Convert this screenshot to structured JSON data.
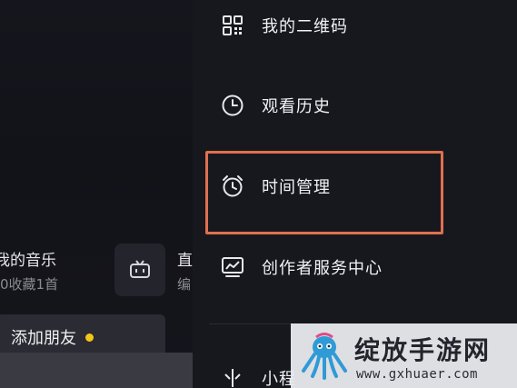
{
  "left": {
    "music_title": "我的音乐",
    "music_sub": "0收藏1首",
    "cut_title": "直",
    "cut_sub": "编",
    "add_friend_label": "添加朋友"
  },
  "menu": {
    "items": [
      {
        "label": "我的二维码",
        "icon": "qr-code-icon"
      },
      {
        "label": "观看历史",
        "icon": "clock-icon"
      },
      {
        "label": "时间管理",
        "icon": "alarm-clock-icon"
      },
      {
        "label": "创作者服务中心",
        "icon": "chart-monitor-icon"
      },
      {
        "label": "小程",
        "icon": "mini-program-icon"
      }
    ]
  },
  "watermark": {
    "title": "绽放手游网",
    "url": "www.gxhuaer.com"
  },
  "colors": {
    "highlight": "#e0704f",
    "badge_dot": "#f5c518"
  }
}
